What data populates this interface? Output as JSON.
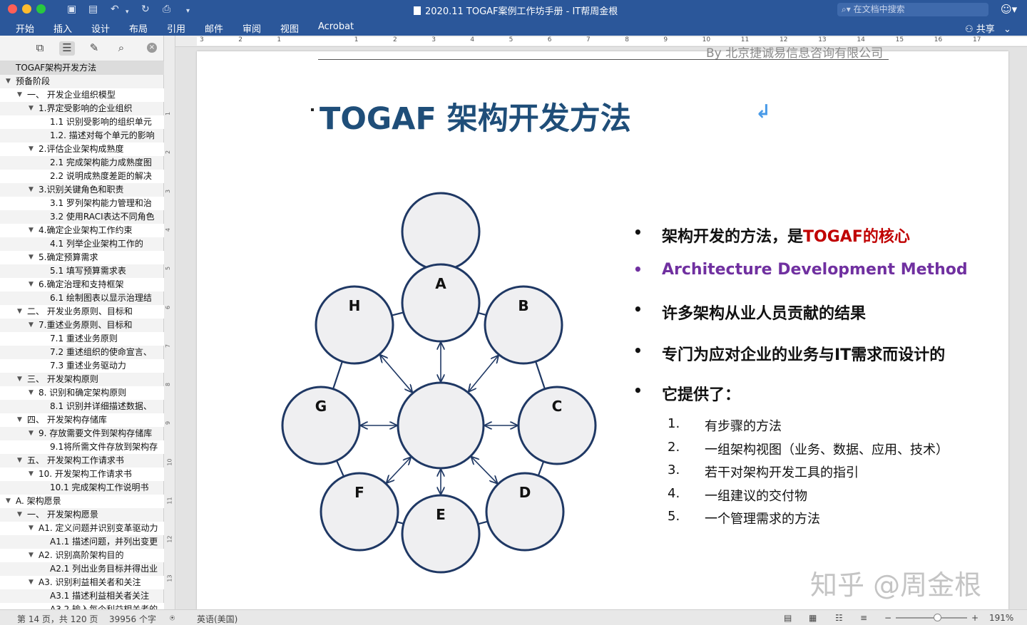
{
  "titlebar": {
    "title": "2020.11 TOGAF案例工作坊手册 - IT帮周金根",
    "search_placeholder": "在文档中搜索"
  },
  "ribbon": {
    "tabs": [
      "开始",
      "插入",
      "设计",
      "布局",
      "引用",
      "邮件",
      "审阅",
      "视图",
      "Acrobat"
    ],
    "share_label": "共享"
  },
  "sidebar": {
    "items": [
      {
        "label": "TOGAF架构开发方法",
        "level": 0,
        "toggle": false
      },
      {
        "label": "预备阶段",
        "level": 0,
        "toggle": true
      },
      {
        "label": "一、 开发企业组织模型",
        "level": 1,
        "toggle": true
      },
      {
        "label": "1.界定受影响的企业组织",
        "level": 2,
        "toggle": true
      },
      {
        "label": "1.1 识别受影响的组织单元",
        "level": 3,
        "toggle": false
      },
      {
        "label": "1.2. 描述对每个单元的影响",
        "level": 3,
        "toggle": false
      },
      {
        "label": "2.评估企业架构成熟度",
        "level": 2,
        "toggle": true
      },
      {
        "label": "2.1 完成架构能力成熟度图",
        "level": 3,
        "toggle": false
      },
      {
        "label": "2.2 说明成熟度差距的解决",
        "level": 3,
        "toggle": false
      },
      {
        "label": "3.识别关键角色和职责",
        "level": 2,
        "toggle": true
      },
      {
        "label": "3.1 罗列架构能力管理和治",
        "level": 3,
        "toggle": false
      },
      {
        "label": "3.2 使用RACI表达不同角色",
        "level": 3,
        "toggle": false
      },
      {
        "label": "4.确定企业架构工作约束",
        "level": 2,
        "toggle": true
      },
      {
        "label": "4.1 列举企业架构工作的",
        "level": 3,
        "toggle": false
      },
      {
        "label": "5.确定预算需求",
        "level": 2,
        "toggle": true
      },
      {
        "label": "5.1 填写预算需求表",
        "level": 3,
        "toggle": false
      },
      {
        "label": "6.确定治理和支持框架",
        "level": 2,
        "toggle": true
      },
      {
        "label": "6.1 绘制图表以显示治理结",
        "level": 3,
        "toggle": false
      },
      {
        "label": "二、 开发业务原则、目标和",
        "level": 1,
        "toggle": true
      },
      {
        "label": "7.重述业务原则、目标和",
        "level": 2,
        "toggle": true
      },
      {
        "label": "7.1 重述业务原则",
        "level": 3,
        "toggle": false
      },
      {
        "label": "7.2 重述组织的使命宣言、",
        "level": 3,
        "toggle": false
      },
      {
        "label": "7.3 重述业务驱动力",
        "level": 3,
        "toggle": false
      },
      {
        "label": "三、 开发架构原则",
        "level": 1,
        "toggle": true
      },
      {
        "label": "8. 识别和确定架构原则",
        "level": 2,
        "toggle": true
      },
      {
        "label": "8.1 识别并详细描述数据、",
        "level": 3,
        "toggle": false
      },
      {
        "label": "四、 开发架构存储库",
        "level": 1,
        "toggle": true
      },
      {
        "label": "9. 存放需要文件到架构存储库",
        "level": 2,
        "toggle": true
      },
      {
        "label": "9.1将所需文件存放到架构存",
        "level": 3,
        "toggle": false
      },
      {
        "label": "五、 开发架构工作请求书",
        "level": 1,
        "toggle": true
      },
      {
        "label": "10. 开发架构工作请求书",
        "level": 2,
        "toggle": true
      },
      {
        "label": "10.1 完成架构工作说明书",
        "level": 3,
        "toggle": false
      },
      {
        "label": "A. 架构愿景",
        "level": 0,
        "toggle": true
      },
      {
        "label": "一、 开发架构愿景",
        "level": 1,
        "toggle": true
      },
      {
        "label": "A1. 定义问题并识别变革驱动力",
        "level": 2,
        "toggle": true
      },
      {
        "label": "A1.1 描述问题，并列出变更",
        "level": 3,
        "toggle": false
      },
      {
        "label": "A2. 识别高阶架构目的",
        "level": 2,
        "toggle": true
      },
      {
        "label": "A2.1 列出业务目标并得出业",
        "level": 3,
        "toggle": false
      },
      {
        "label": "A3. 识别利益相关者和关注",
        "level": 2,
        "toggle": true
      },
      {
        "label": "A3.1 描述利益相关者关注",
        "level": 3,
        "toggle": false
      },
      {
        "label": "A3.2 输入每个利益相关者的",
        "level": 3,
        "toggle": false
      }
    ]
  },
  "document": {
    "header_text": "By 北京捷诚易信息咨询有限公司",
    "heading": "TOGAF 架构开发方法",
    "diagram": {
      "nodes": [
        {
          "id": "top",
          "label": ""
        },
        {
          "id": "A",
          "label": "A"
        },
        {
          "id": "B",
          "label": "B"
        },
        {
          "id": "C",
          "label": "C"
        },
        {
          "id": "D",
          "label": "D"
        },
        {
          "id": "E",
          "label": "E"
        },
        {
          "id": "F",
          "label": "F"
        },
        {
          "id": "G",
          "label": "G"
        },
        {
          "id": "H",
          "label": "H"
        },
        {
          "id": "center",
          "label": ""
        }
      ],
      "node_fill": "#efeff1",
      "node_stroke": "#1f3864"
    },
    "bullets": [
      {
        "text": "架构开发的方法，是",
        "highlight": "TOGAF的核心",
        "color": "#111111"
      },
      {
        "text": "Architecture  Development  Method",
        "highlight": "",
        "color": "#7030a0"
      },
      {
        "text": "许多架构从业人员贡献的结果",
        "highlight": "",
        "color": "#111111"
      },
      {
        "text": "专门为应对企业的业务与IT需求而设计的",
        "highlight": "",
        "color": "#111111"
      },
      {
        "text": "它提供了：",
        "highlight": "",
        "color": "#111111"
      }
    ],
    "numbered": [
      {
        "num": "1.",
        "text": "有步骤的方法"
      },
      {
        "num": "2.",
        "text": "一组架构视图（业务、数据、应用、技术）"
      },
      {
        "num": "3.",
        "text": "若干对架构开发工具的指引"
      },
      {
        "num": "4.",
        "text": "一组建议的交付物"
      },
      {
        "num": "5.",
        "text": "一个管理需求的方法"
      }
    ],
    "watermark": "知乎 @周金根"
  },
  "statusbar": {
    "page_info": "第 14 页，共 120 页",
    "word_count": "39956 个字",
    "language": "英语(美国)",
    "zoom": "191%"
  },
  "colors": {
    "ribbon": "#2b579a",
    "heading": "#1f4e79",
    "highlight_red": "#c00000",
    "highlight_purple": "#7030a0"
  }
}
